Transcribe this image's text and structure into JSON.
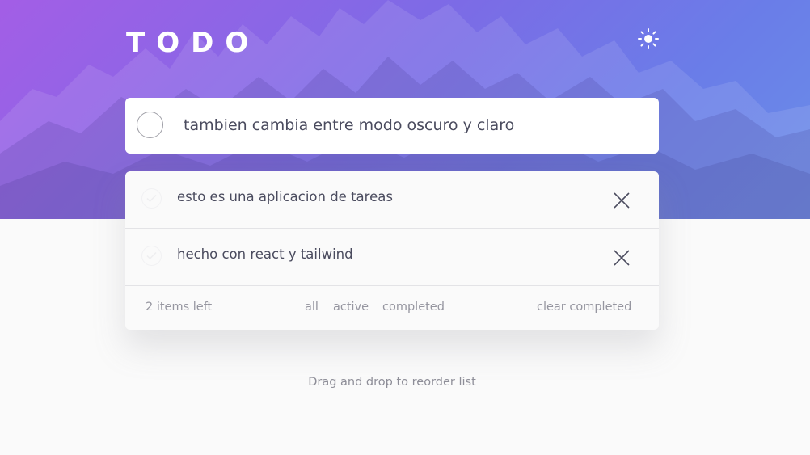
{
  "header": {
    "title": "TODO",
    "theme_toggle_icon": "sun-icon"
  },
  "new_todo": {
    "value": "tambien cambia entre modo oscuro y claro",
    "placeholder": ""
  },
  "todos": [
    {
      "text": "esto es una aplicacion de tareas",
      "completed": false
    },
    {
      "text": "hecho con react y tailwind",
      "completed": false
    }
  ],
  "footer": {
    "items_left": "2 items left",
    "filters": [
      "all",
      "active",
      "completed"
    ],
    "clear_completed": "clear completed"
  },
  "hint": "Drag and drop to reorder list",
  "colors": {
    "gradient_start": "#a35ee6",
    "gradient_end": "#6b8ee8",
    "text_primary": "#4a4b5e",
    "text_muted": "#9696a0",
    "background": "#fafafa"
  },
  "icons": {
    "theme": "sun-icon",
    "delete": "cross-icon",
    "check": "check-icon"
  }
}
